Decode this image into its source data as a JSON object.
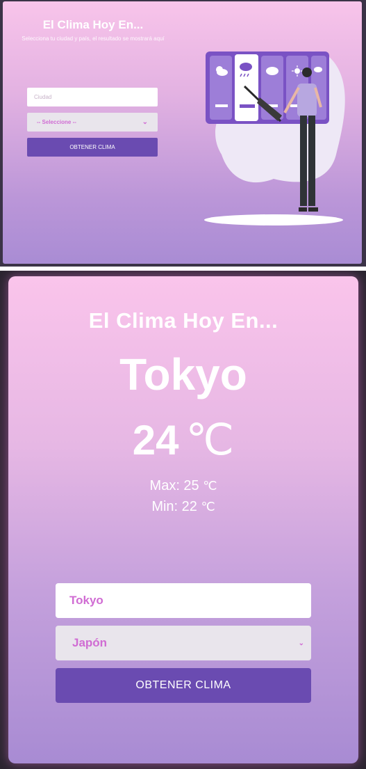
{
  "top": {
    "title": "El Clima Hoy En...",
    "subtitle": "Selecciona tu ciudad y país, el resultado se mostrará aquí",
    "city_placeholder": "Ciudad",
    "country_select_value": "-- Seleccione --",
    "button_label": "OBTENER CLIMA"
  },
  "bottom": {
    "title": "El Clima Hoy En...",
    "city_name": "Tokyo",
    "temperature": "24",
    "temp_unit": "℃",
    "max_label": "Max: 25",
    "min_label": "Min: 22",
    "unit_small": "℃",
    "city_value": "Tokyo",
    "country_select_value": "Japón",
    "button_label": "OBTENER CLIMA"
  },
  "icons": {
    "chevron": "chevron-down-icon",
    "weather": [
      "partly-cloudy-icon",
      "rain-cloud-icon",
      "cloud-icon",
      "sun-icon",
      "cloud-rain-icon"
    ],
    "illustration": "person-with-umbrella-illustration"
  },
  "colors": {
    "accent": "#6a4bb1",
    "placeholder_pink": "#d06cd3",
    "gradient_top": "#f8c4ea",
    "gradient_bottom": "#a98cd4"
  }
}
